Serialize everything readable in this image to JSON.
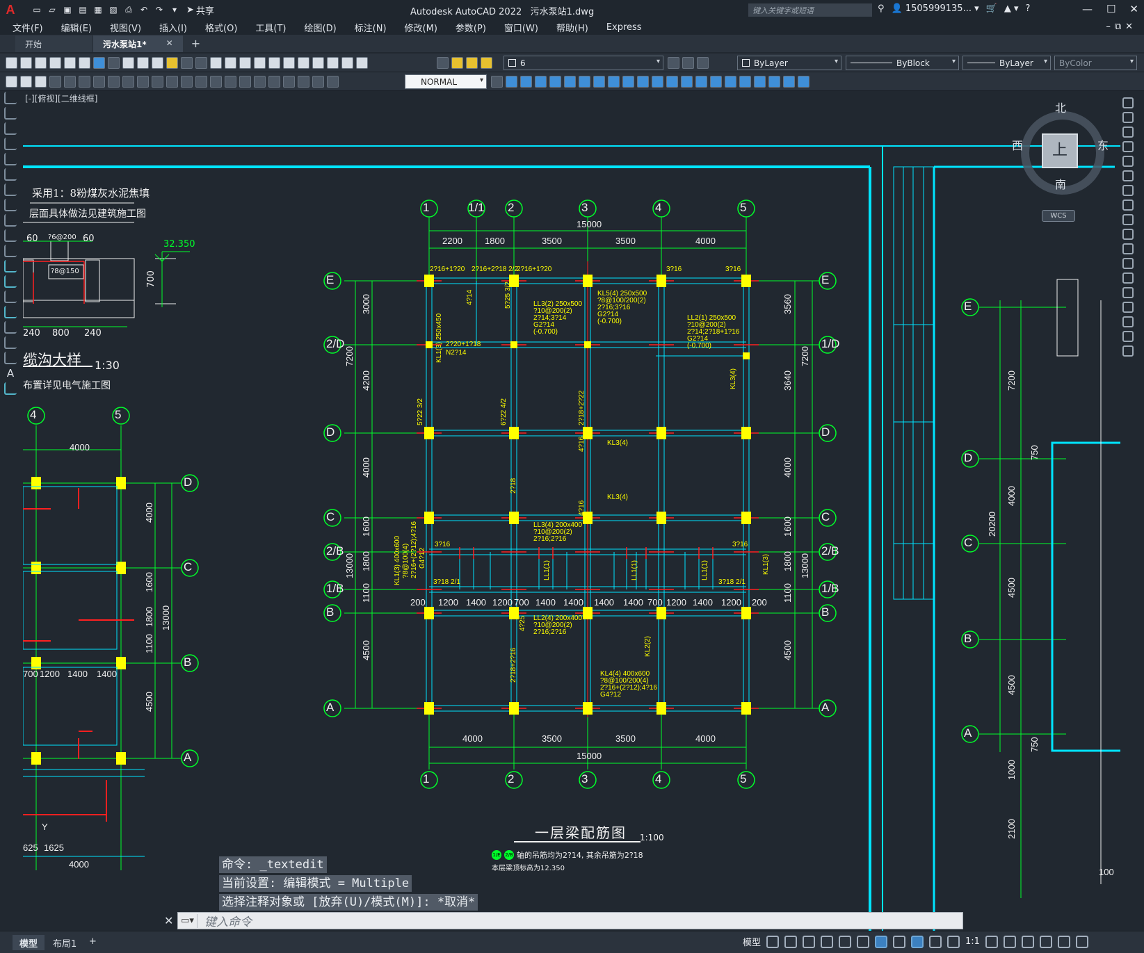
{
  "app": {
    "logo": "A",
    "title": "Autodesk AutoCAD 2022",
    "file": "污水泵站1.dwg",
    "share_label": "共享",
    "search_placeholder": "键入关键字或短语",
    "user": "1505999135...",
    "help": "?"
  },
  "menu": [
    "文件(F)",
    "编辑(E)",
    "视图(V)",
    "插入(I)",
    "格式(O)",
    "工具(T)",
    "绘图(D)",
    "标注(N)",
    "修改(M)",
    "参数(P)",
    "窗口(W)",
    "帮助(H)",
    "Express"
  ],
  "tabs": {
    "home": "开始",
    "active": "污水泵站1*",
    "close": "✕",
    "add": "+"
  },
  "toolbar": {
    "layer": "6",
    "color": "ByLayer",
    "linetype": "ByBlock",
    "lineweight": "ByLayer",
    "plotstyle": "ByColor",
    "textstyle": "NORMAL"
  },
  "viewport": {
    "label": "[-][俯视][二维线框]",
    "viewcube": {
      "top": "上",
      "north": "北",
      "south": "南",
      "east": "东",
      "west": "西",
      "wcs": "WCS"
    }
  },
  "drawing": {
    "main_title": "一层梁配筋图",
    "main_scale": "1:100",
    "note_1": "轴的吊筋均为2?14, 其余吊筋为2?18",
    "note_1_badges": [
      "1/E",
      "2/B"
    ],
    "note_2": "本层梁顶标高为12.350",
    "top_total": "15000",
    "bottom_total": "15000",
    "top_dims": [
      "2200",
      "1800",
      "3500",
      "3500",
      "4000"
    ],
    "bottom_dims": [
      "4000",
      "3500",
      "3500",
      "4000"
    ],
    "top_axes": [
      "1",
      "1/1",
      "2",
      "3",
      "4",
      "5"
    ],
    "bottom_axes": [
      "1",
      "2",
      "3",
      "4",
      "5"
    ],
    "left_axes": [
      "E",
      "2/D",
      "D",
      "C",
      "2/B",
      "1/B",
      "B",
      "A"
    ],
    "right_axes": [
      "E",
      "1/D",
      "D",
      "C",
      "2/B",
      "1/B",
      "B",
      "A"
    ],
    "left_dims": [
      "3000",
      "4200",
      "4000",
      "1600",
      "1800",
      "1100",
      "4500"
    ],
    "left_total": "7200",
    "left_total_2": "13000",
    "right_dims": [
      "3560",
      "3640",
      "4000",
      "1600",
      "1800",
      "1100",
      "4500"
    ],
    "right_total": "7200",
    "right_total_2": "13000",
    "mid_dims": [
      "200",
      "1200",
      "1400",
      "1200",
      "700",
      "1400",
      "1400",
      "1400",
      "1400",
      "700",
      "1200",
      "1400",
      "1200",
      "200"
    ],
    "detail_note_1": "采用1：8粉煤灰水泥焦填",
    "detail_note_2": "层面具体做法见建筑施工图",
    "detail_elev": "32.350",
    "detail_dims": [
      "60",
      "60",
      "700",
      "240",
      "800",
      "240"
    ],
    "detail_bars": [
      "?6@200",
      "?8@150"
    ],
    "section_title": "缆沟大样",
    "section_scale": "1:30",
    "section_note": "布置详见电气施工图",
    "small_axes_top": [
      "4",
      "5"
    ],
    "small_axes_right": [
      "D",
      "C",
      "B",
      "A"
    ],
    "small_top_dim": "4000",
    "small_dims": [
      "4000",
      "1600",
      "1800",
      "1100",
      "4500"
    ],
    "small_total": "13000",
    "small_bottom_dims": [
      "700",
      "1200",
      "1400",
      "1400"
    ],
    "small_extra": [
      "625",
      "1625",
      "4000"
    ],
    "small_label": "Y",
    "right_axes_col": [
      "E",
      "D",
      "C",
      "B",
      "A"
    ],
    "right_col_dims": [
      "7200",
      "4000",
      "4500",
      "4500",
      "1000",
      "2100"
    ],
    "right_col_total": "20200",
    "right_col_extra": [
      "750",
      "750",
      "100"
    ],
    "beam_labels": [
      "2?16+1?20",
      "2?16+2?18 2/2",
      "2?16+1?20",
      "3?16",
      "3?16",
      "KL1(3) 250x450",
      "2?20+1?18",
      "N2?14",
      "4?14",
      "5?25 3/2",
      "LL3(2) 250x500",
      "?10@200(2)",
      "2?14;3?14",
      "G2?14",
      "(-0.700)",
      "KL5(4) 250x500",
      "?8@100/200(2)",
      "2?16;3?16",
      "G2?14",
      "(-0.700)",
      "LL2(1) 250x500",
      "?10@200(2)",
      "2?14;2?18+1?16",
      "G2?14",
      "(-0.700)",
      "KL3(4)",
      "KL3(4)",
      "KL3(4)",
      "LL3(4) 200x400",
      "?10@200(2)",
      "2?16;2?16",
      "LL2(4) 200x400",
      "?10@200(2)",
      "2?16;2?16",
      "KL4(4) 400x600",
      "?8@100/200(4)",
      "2?16+(2?12);4?16",
      "G4?12",
      "3?16",
      "3?16",
      "3?18 2/1",
      "3?18 2/1",
      "KL2(2)",
      "KL1(3)",
      "LL1(1)",
      "LL1(1)",
      "LL1(1)",
      "KL1(3) 400x600",
      "?8@100(4)",
      "2?16+(2?12);4?16",
      "G4?12",
      "4?25",
      "5?22 3/2",
      "6?22 4/2",
      "2?18+2?22",
      "2?18",
      "4?16",
      "2?18+2?16",
      "4?16",
      "2?20+3?22 3/2"
    ]
  },
  "command": {
    "line1": "命令: _textedit",
    "line2": "当前设置: 编辑模式 = Multiple",
    "line3": "选择注释对象或 [放弃(U)/模式(M)]: *取消*",
    "input_placeholder": "键入命令",
    "close": "✕"
  },
  "layout_tabs": [
    "模型",
    "布局1",
    "+"
  ],
  "status": {
    "model": "模型",
    "scale": "1:1"
  },
  "colors": {
    "bg": "#212830",
    "cyan": "#00e5ff",
    "green": "#00ff2a",
    "yellow": "#ffff00",
    "red": "#ff2020",
    "white": "#f0f0f0"
  }
}
